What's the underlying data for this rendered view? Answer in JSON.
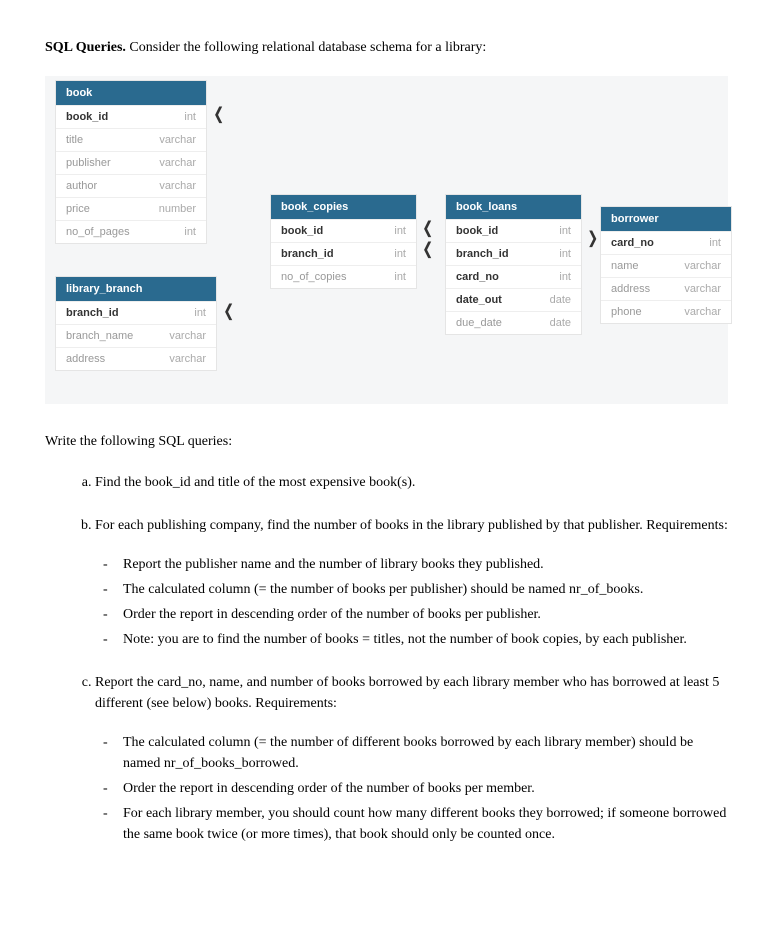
{
  "intro": {
    "bold": "SQL Queries.",
    "rest": " Consider the following relational database schema for a library:"
  },
  "entities": {
    "book": {
      "title": "book",
      "rows": [
        {
          "name": "book_id",
          "type": "int",
          "pk": true
        },
        {
          "name": "title",
          "type": "varchar"
        },
        {
          "name": "publisher",
          "type": "varchar"
        },
        {
          "name": "author",
          "type": "varchar"
        },
        {
          "name": "price",
          "type": "number"
        },
        {
          "name": "no_of_pages",
          "type": "int"
        }
      ]
    },
    "library_branch": {
      "title": "library_branch",
      "rows": [
        {
          "name": "branch_id",
          "type": "int",
          "pk": true
        },
        {
          "name": "branch_name",
          "type": "varchar"
        },
        {
          "name": "address",
          "type": "varchar"
        }
      ]
    },
    "book_copies": {
      "title": "book_copies",
      "rows": [
        {
          "name": "book_id",
          "type": "int",
          "pk": true
        },
        {
          "name": "branch_id",
          "type": "int",
          "pk": true
        },
        {
          "name": "no_of_copies",
          "type": "int"
        }
      ]
    },
    "book_loans": {
      "title": "book_loans",
      "rows": [
        {
          "name": "book_id",
          "type": "int",
          "pk": true
        },
        {
          "name": "branch_id",
          "type": "int",
          "pk": true
        },
        {
          "name": "card_no",
          "type": "int",
          "pk": true
        },
        {
          "name": "date_out",
          "type": "date",
          "pk": true
        },
        {
          "name": "due_date",
          "type": "date"
        }
      ]
    },
    "borrower": {
      "title": "borrower",
      "rows": [
        {
          "name": "card_no",
          "type": "int",
          "pk": true
        },
        {
          "name": "name",
          "type": "varchar"
        },
        {
          "name": "address",
          "type": "varchar"
        },
        {
          "name": "phone",
          "type": "varchar"
        }
      ]
    }
  },
  "prompt": "Write the following SQL queries:",
  "questions": {
    "a": "Find the book_id and title of the most expensive book(s).",
    "b": {
      "text": "For each publishing company, find the number of books in the library published by that publisher. Requirements:",
      "reqs": [
        "Report the publisher name and the number of library books they published.",
        "The calculated column (= the number of books per publisher) should be named nr_of_books.",
        "Order the report in descending order of the number of books per publisher.",
        "Note: you are to find the number of books = titles, not the number of book copies, by each publisher."
      ]
    },
    "c": {
      "text": "Report the card_no, name, and number of books borrowed by each library member who has borrowed at least 5 different (see below) books. Requirements:",
      "reqs": [
        "The calculated column (= the number of different books borrowed by each library member) should be named nr_of_books_borrowed.",
        "Order the report in descending order of the number of books per member.",
        "For each library member, you should count how many different books they borrowed; if someone borrowed the same book twice (or more times), that book should only be counted once."
      ]
    }
  }
}
